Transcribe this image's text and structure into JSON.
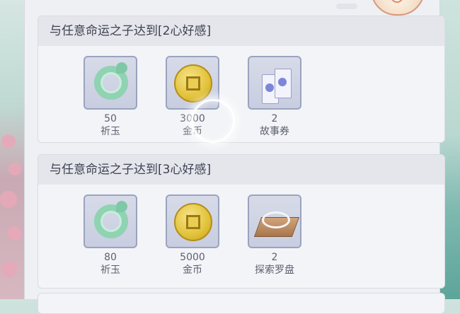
{
  "sections": [
    {
      "title": "与任意命运之子达到[2心好感]",
      "rewards": [
        {
          "icon": "jade-icon",
          "qty": "50",
          "name": "祈玉"
        },
        {
          "icon": "gold-coin-icon",
          "qty": "3000",
          "name": "金币"
        },
        {
          "icon": "story-ticket-icon",
          "qty": "2",
          "name": "故事券"
        }
      ]
    },
    {
      "title": "与任意命运之子达到[3心好感]",
      "rewards": [
        {
          "icon": "jade-icon",
          "qty": "80",
          "name": "祈玉"
        },
        {
          "icon": "gold-coin-icon",
          "qty": "5000",
          "name": "金币"
        },
        {
          "icon": "compass-icon",
          "qty": "2",
          "name": "探索罗盘"
        }
      ]
    }
  ],
  "colors": {
    "panel": "#eef0f4",
    "tile": "#c8cde0",
    "tile_border": "#9aa3bf",
    "title_bg": "#e4e6ec"
  }
}
